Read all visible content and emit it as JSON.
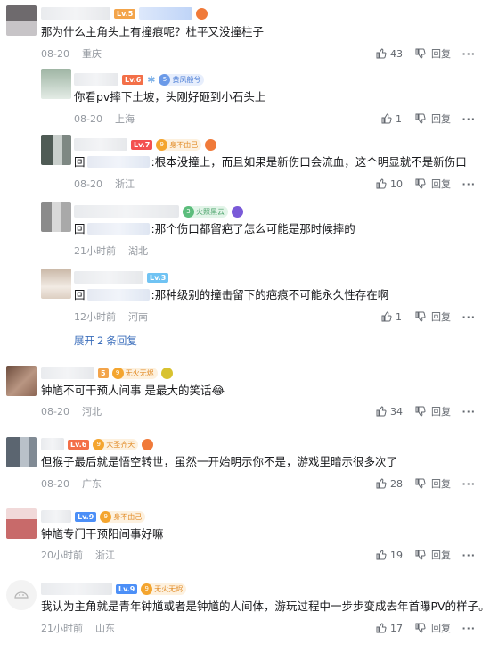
{
  "comments": [
    {
      "level": "Lv.5",
      "text": "那为什么主角头上有撞痕呢？杜平又没撞柱子",
      "date": "08-20",
      "location": "重庆",
      "likes": "43",
      "reply_label": "回复",
      "avatar_colors": [
        "#6e6a6d",
        "#c7c4c7",
        "#9a9598"
      ]
    },
    {
      "level": "Lv.6",
      "medal": "黄凤般兮",
      "text": "你看pv摔下土坡，头刚好砸到小石头上",
      "date": "08-20",
      "location": "上海",
      "likes": "1",
      "reply_label": "回复",
      "avatar_colors": [
        "#9fb5a4",
        "#e4ece6",
        "#bacbbd"
      ]
    },
    {
      "level": "Lv.7",
      "medal": "身不由己",
      "reply_prefix": "回",
      "text": ":根本没撞上，而且如果是新伤口会流血，这个明显就不是新伤口",
      "date": "08-20",
      "location": "浙江",
      "likes": "10",
      "reply_label": "回复",
      "avatar_colors": [
        "#4f5b55",
        "#c9cfcc",
        "#7e8883"
      ]
    },
    {
      "medal": "火照黑云",
      "reply_prefix": "回",
      "text": ":那个伤口都留疤了怎么可能是那时候摔的",
      "date": "21小时前",
      "location": "湖北",
      "likes": "",
      "reply_label": "回复",
      "avatar_colors": [
        "#8b8b8b",
        "#d8d8d8",
        "#a9a9a9"
      ]
    },
    {
      "level": "Lv.3",
      "reply_prefix": "回",
      "text": ":那种级别的撞击留下的疤痕不可能永久性存在啊",
      "date": "12小时前",
      "location": "河南",
      "likes": "1",
      "reply_label": "回复",
      "avatar_colors": [
        "#c9b7a6",
        "#f2ebe4",
        "#ddcfc2"
      ]
    },
    {
      "level": "5",
      "medal": "无火无烬",
      "text": "钟馗不可干预人间事 是最大的笑话😂",
      "date": "08-20",
      "location": "河北",
      "likes": "34",
      "reply_label": "回复",
      "avatar_colors": [
        "#6d4c3d",
        "#b99682",
        "#8c6654"
      ]
    },
    {
      "level": "Lv.6",
      "medal": "大圣齐天",
      "text": "但猴子最后就是悟空转世，虽然一开始明示你不是，游戏里暗示很多次了",
      "date": "08-20",
      "location": "广东",
      "likes": "28",
      "reply_label": "回复",
      "avatar_colors": [
        "#5b6570",
        "#b9c1c9",
        "#808a94"
      ]
    },
    {
      "level": "Lv.9",
      "medal": "身不由己",
      "text": "钟馗专门干预阳间事好嘛",
      "date": "20小时前",
      "location": "浙江",
      "likes": "19",
      "reply_label": "回复",
      "avatar_colors": [
        "#c86a6a",
        "#f1d9d9",
        "#d99898"
      ]
    },
    {
      "level": "Lv.9",
      "medal": "无火无烬",
      "text": "我认为主角就是青年钟馗或者是钟馗的人间体，游玩过程中一步步变成去年首曝PV的样子。",
      "date": "21小时前",
      "location": "山东",
      "likes": "17",
      "reply_label": "回复",
      "avatar_colors": [
        "#f1f1f1",
        "#ffffff",
        "#e4e4e4"
      ]
    }
  ],
  "expand": {
    "prefix": "展开",
    "count": "2",
    "suffix": "条回复"
  }
}
